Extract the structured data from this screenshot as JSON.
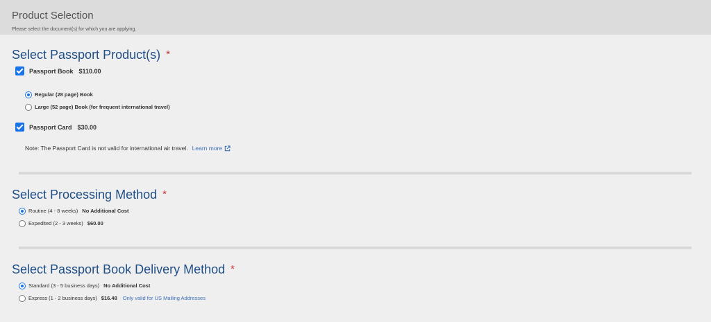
{
  "header": {
    "title": "Product Selection",
    "subtitle": "Please select the document(s) for which you are applying."
  },
  "passport_products": {
    "title": "Select Passport Product(s)",
    "required_mark": "*",
    "book": {
      "label": "Passport Book",
      "price": "$110.00",
      "checked": true
    },
    "book_options": [
      {
        "label": "Regular (28 page) Book",
        "selected": true
      },
      {
        "label": "Large (52 page) Book (for frequent international travel)",
        "selected": false
      }
    ],
    "card": {
      "label": "Passport Card",
      "price": "$30.00",
      "checked": true
    },
    "note": "Note: The Passport Card is not valid for international air travel.",
    "learn_more": "Learn more"
  },
  "processing": {
    "title": "Select Processing Method",
    "required_mark": "*",
    "options": [
      {
        "label": "Routine (4 - 8 weeks)",
        "cost": "No Additional Cost",
        "selected": true
      },
      {
        "label": "Expedited (2 - 3 weeks)",
        "cost": "$60.00",
        "selected": false
      }
    ]
  },
  "delivery": {
    "title": "Select Passport Book Delivery Method",
    "required_mark": "*",
    "options": [
      {
        "label": "Standard (3 - 5 business days)",
        "cost": "No Additional Cost",
        "note": "",
        "selected": true
      },
      {
        "label": "Express (1 - 2 business days)",
        "cost": "$16.48",
        "note": "Only valid for US Mailing Addresses",
        "selected": false
      }
    ]
  },
  "colors": {
    "accent": "#1a73e8",
    "heading": "#1f4e86",
    "required": "#c23636",
    "link": "#3b6fb6"
  }
}
